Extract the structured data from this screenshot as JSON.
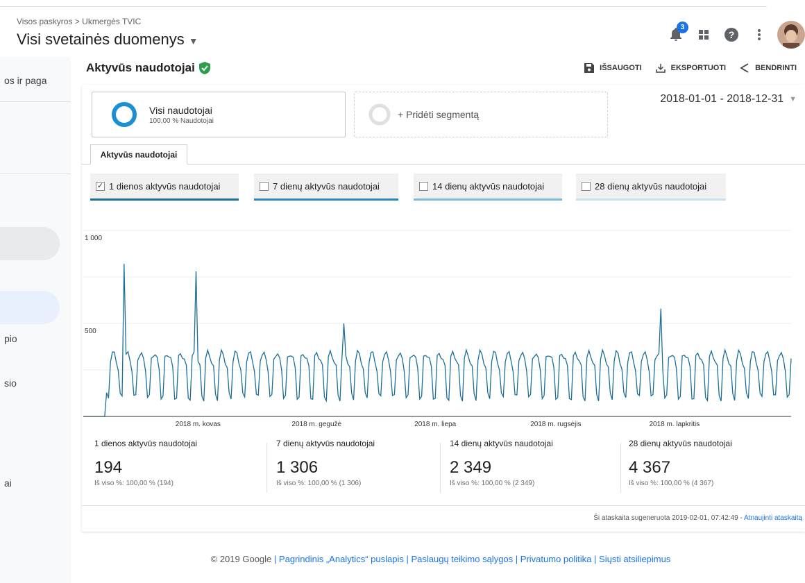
{
  "header": {
    "breadcrumb": "Visos paskyros > Ukmergės TVIC",
    "view_title": "Visi svetainės duomenys",
    "notification_count": "3"
  },
  "sidebar": {
    "texts": [
      "os ir paga",
      "pio",
      "sio",
      "ai"
    ]
  },
  "report": {
    "title": "Aktyvūs naudotojai",
    "actions": {
      "save": "IŠSAUGOTI",
      "export": "EKSPORTUOTI",
      "share": "BENDRINTI"
    },
    "segment_active": {
      "name": "Visi naudotojai",
      "sub": "100,00 % Naudotojai"
    },
    "segment_add": "+ Pridėti segmentą",
    "date_range": "2018-01-01 - 2018-12-31",
    "tab": "Aktyvūs naudotojai",
    "metrics": [
      {
        "label": "1 dienos aktyvūs naudotojai",
        "checked": true,
        "color": "#1a6f9a"
      },
      {
        "label": "7 dienų aktyvūs naudotojai",
        "checked": false,
        "color": "#2b87c0"
      },
      {
        "label": "14 dienų aktyvūs naudotojai",
        "checked": false,
        "color": "#7fb8df"
      },
      {
        "label": "28 dienų aktyvūs naudotojai",
        "checked": false,
        "color": "#c9e0f0"
      }
    ],
    "summary": [
      {
        "label": "1 dienos aktyvūs naudotojai",
        "value": "194",
        "sub": "Iš viso %: 100,00 % (194)"
      },
      {
        "label": "7 dienų aktyvūs naudotojai",
        "value": "1 306",
        "sub": "Iš viso %: 100,00 % (1 306)"
      },
      {
        "label": "14 dienų aktyvūs naudotojai",
        "value": "2 349",
        "sub": "Iš viso %: 100,00 % (2 349)"
      },
      {
        "label": "28 dienų aktyvūs naudotojai",
        "value": "4 367",
        "sub": "Iš viso %: 100,00 % (4 367)"
      }
    ],
    "generated_text": "Ši ataskaita sugeneruota 2019-02-01, 07:42:49 - ",
    "refresh_link": "Atnaujinti ataskaitą"
  },
  "footer": {
    "copyright": "© 2019 Google",
    "links": [
      "Pagrindinis „Analytics“ puslapis",
      "Paslaugų teikimo sąlygos",
      "Privatumo politika",
      "Siųsti atsiliepimus"
    ]
  },
  "chart_data": {
    "type": "line",
    "series": [
      {
        "name": "1 dienos aktyvūs naudotojai",
        "color": "#1a6f9a"
      }
    ],
    "x_start": "2018-01-01",
    "x_end": "2018-12-31",
    "xticks": [
      {
        "label": "2018 m. kovas",
        "date": "2018-03-01"
      },
      {
        "label": "2018 m. gegužė",
        "date": "2018-05-01"
      },
      {
        "label": "2018 m. liepa",
        "date": "2018-07-01"
      },
      {
        "label": "2018 m. rugsėjis",
        "date": "2018-09-01"
      },
      {
        "label": "2018 m. lapkritis",
        "date": "2018-11-01"
      }
    ],
    "yticks": [
      {
        "label": "1 000",
        "value": 1000
      },
      {
        "label": "500",
        "value": 500
      }
    ],
    "ylim": [
      0,
      1000
    ],
    "weekday_pattern": [
      310,
      340,
      330,
      300,
      260,
      110,
      100
    ],
    "spikes": [
      {
        "date": "2018-01-22",
        "value": 820
      },
      {
        "date": "2018-02-28",
        "value": 780
      },
      {
        "date": "2018-05-15",
        "value": 500
      },
      {
        "date": "2018-10-25",
        "value": 580
      }
    ],
    "start_values": [
      {
        "date": "2018-01-01",
        "value": 0
      },
      {
        "date": "2018-01-12",
        "value": 0
      }
    ]
  }
}
